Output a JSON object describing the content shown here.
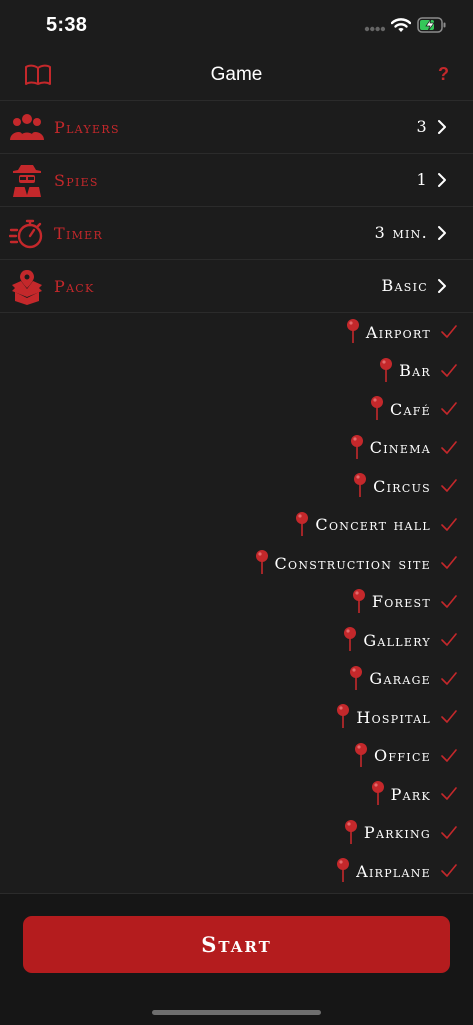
{
  "status_bar": {
    "time": "5:38"
  },
  "nav": {
    "title": "Game",
    "help_label": "?"
  },
  "settings": [
    {
      "label": "Players",
      "value": "3",
      "icon": "people-group-icon"
    },
    {
      "label": "Spies",
      "value": "1",
      "icon": "spy-icon"
    },
    {
      "label": "Timer",
      "value": "3 min.",
      "icon": "stopwatch-icon"
    },
    {
      "label": "Pack",
      "value": "Basic",
      "icon": "box-pin-icon"
    }
  ],
  "locations": [
    "Airport",
    "Bar",
    "Café",
    "Cinema",
    "Circus",
    "Concert hall",
    "Construction site",
    "Forest",
    "Gallery",
    "Garage",
    "Hospital",
    "Office",
    "Park",
    "Parking",
    "Airplane"
  ],
  "start_label": "Start",
  "colors": {
    "background": "#1c1c1c",
    "accent": "#c4282b",
    "button": "#b41c1e",
    "text": "#ffffff"
  }
}
